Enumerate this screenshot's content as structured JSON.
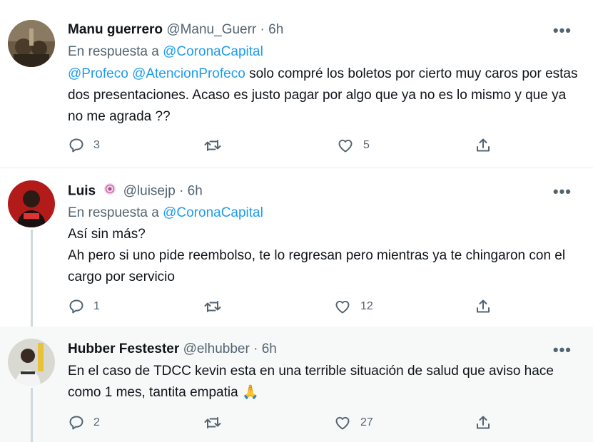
{
  "tweets": [
    {
      "name": "Manu guerrero",
      "handle": "@Manu_Guerr",
      "dot": "·",
      "time": "6h",
      "reply_label": "En respuesta a",
      "reply_target": "@CoronaCapital",
      "mention_1": "@Profeco",
      "mention_2": "@AtencionProfeco",
      "body_rest": "solo compré los boletos por cierto muy caros por estas dos presentaciones. Acaso es justo pagar por algo que ya no es lo mismo y que ya no me agrada ??",
      "replies": "3",
      "retweets": "",
      "likes": "5"
    },
    {
      "name": "Luis",
      "handle": "@luisejp",
      "dot": "·",
      "time": "6h",
      "reply_label": "En respuesta a",
      "reply_target": "@CoronaCapital",
      "line_1": "Así sin más?",
      "line_2": "Ah pero si uno pide reembolso, te lo regresan pero mientras ya te chingaron con el cargo por servicio",
      "replies": "1",
      "retweets": "",
      "likes": "12"
    },
    {
      "name": "Hubber Festester",
      "handle": "@elhubber",
      "dot": "·",
      "time": "6h",
      "body": "En el caso de TDCC kevin esta en una terrible situación de salud que aviso hace como 1 mes, tantita empatia",
      "emoji": "🙏",
      "replies": "2",
      "retweets": "",
      "likes": "27"
    }
  ],
  "more_label": "•••",
  "icons": [
    "reply-icon",
    "retweet-icon",
    "like-icon",
    "share-icon",
    "more-icon",
    "badge-icon"
  ],
  "colors": {
    "link": "#1d9bf0",
    "secondary": "#536471",
    "text": "#0f1419",
    "highlight": "#f7f9f9"
  }
}
